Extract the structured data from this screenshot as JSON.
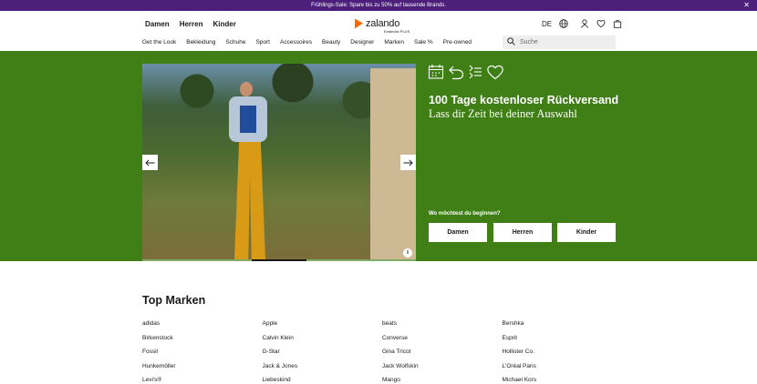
{
  "promo_bar": {
    "text": "Frühlings-Sale: Spare bis zu 50% auf tausende Brands.",
    "close_label": "✕"
  },
  "header": {
    "gender_nav": [
      "Damen",
      "Herren",
      "Kinder"
    ],
    "logo": {
      "name": "zalando",
      "subtitle": "Entdecke PLUS"
    },
    "language": "DE",
    "icons": [
      "globe-icon",
      "user-icon",
      "heart-icon",
      "bag-icon"
    ],
    "categories": [
      "Get the Look",
      "Bekleidung",
      "Schuhe",
      "Sport",
      "Accessoires",
      "Beauty",
      "Designer",
      "Marken",
      "Sale %",
      "Pre-owned"
    ],
    "search": {
      "placeholder": "Suche"
    }
  },
  "hero": {
    "icons": [
      "calendar-icon",
      "return-arrow-icon",
      "list-icon",
      "heart-icon"
    ],
    "title": "100 Tage kostenloser Rückversand",
    "subtitle": "Lass dir Zeit bei deiner Auswahl",
    "question": "Wo möchtest du beginnen?",
    "cta_buttons": [
      "Damen",
      "Herren",
      "Kinder"
    ],
    "pause_label": "II",
    "progress": {
      "active_slide": 3,
      "total_slides": 5
    },
    "colors": {
      "background": "#3f7f16",
      "promo_bar": "#4b1f7a",
      "logo_accent": "#ff6900"
    }
  },
  "brands": {
    "title": "Top Marken",
    "items": [
      "adidas",
      "Apple",
      "beats",
      "Bershka",
      "Birkenstock",
      "Calvin Klein",
      "Converse",
      "Esprit",
      "Fossil",
      "G-Star",
      "Gina Tricot",
      "Hollister Co.",
      "Hunkemöller",
      "Jack & Jones",
      "Jack Wolfskin",
      "L'Oréal Paris",
      "Levi's®",
      "Liebeskind",
      "Mango",
      "Michael Kors"
    ]
  }
}
